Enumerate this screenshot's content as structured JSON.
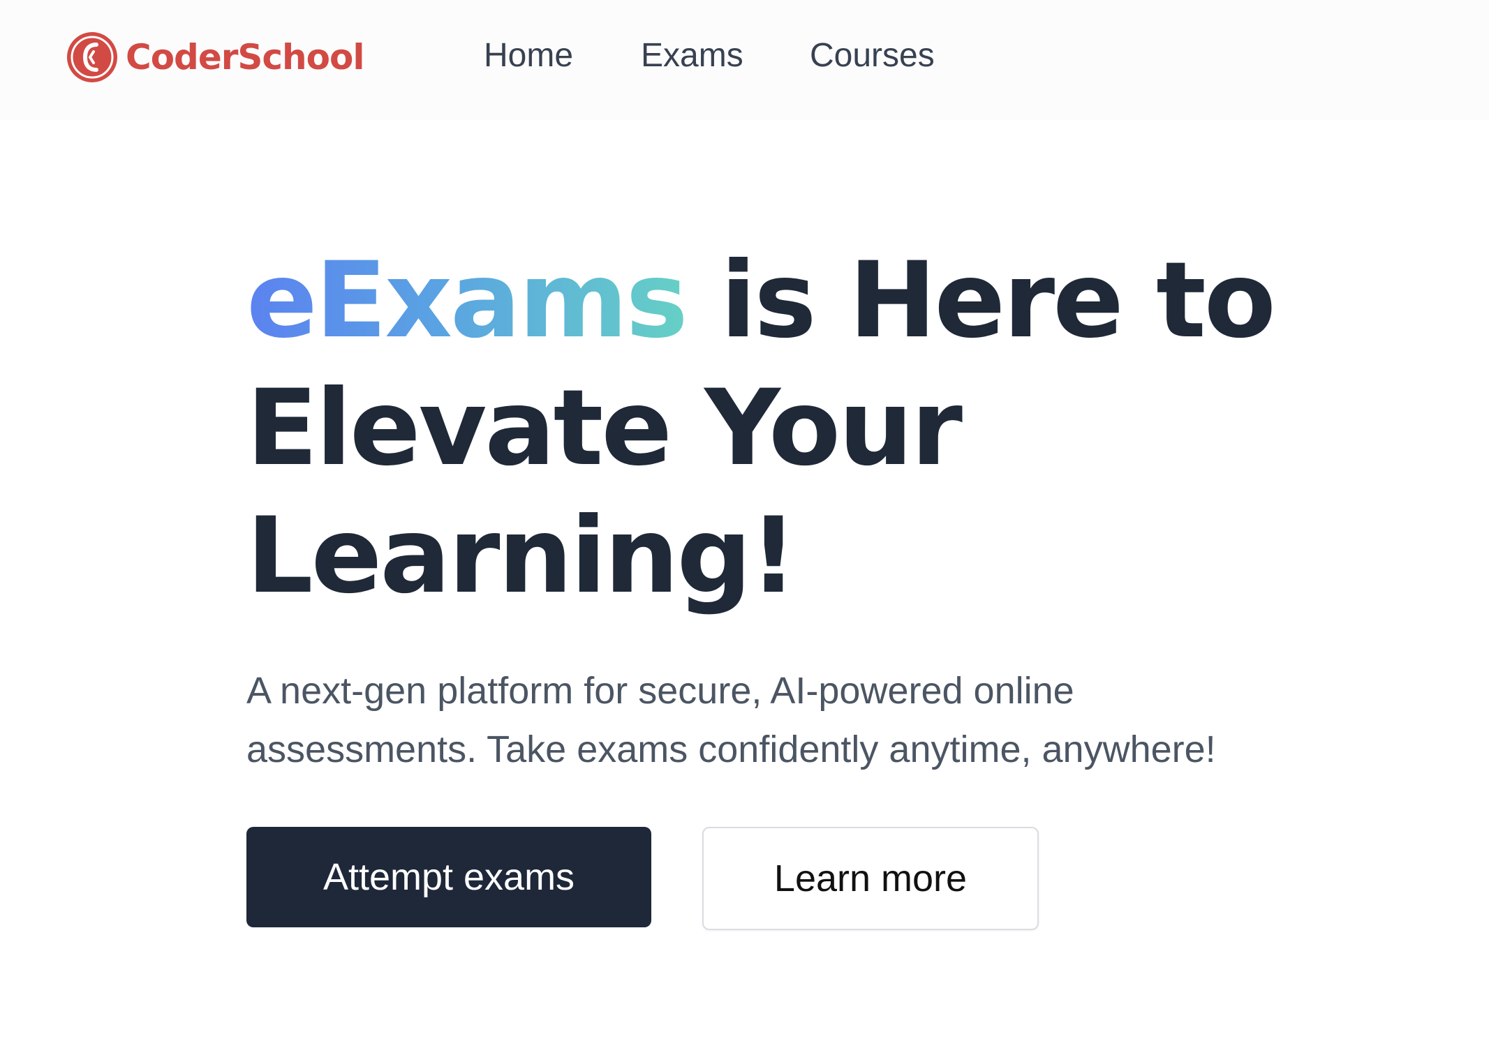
{
  "brand": {
    "name": "CoderSchool",
    "color": "#d24a44"
  },
  "nav": {
    "items": [
      {
        "label": "Home"
      },
      {
        "label": "Exams"
      },
      {
        "label": "Courses"
      }
    ]
  },
  "hero": {
    "headline_highlight": "eExams",
    "headline_rest_line1": " is Here to",
    "headline_line2": "Elevate Your",
    "headline_line3": "Learning!",
    "subtitle_line1": "A next-gen platform for secure, AI-powered online",
    "subtitle_line2": "assessments. Take exams confidently anytime, anywhere!",
    "primary_button": "Attempt exams",
    "secondary_button": "Learn more",
    "gradient_colors": [
      "#5b82f0",
      "#5aa4e2",
      "#66d0c5"
    ],
    "text_color": "#1f2937"
  }
}
